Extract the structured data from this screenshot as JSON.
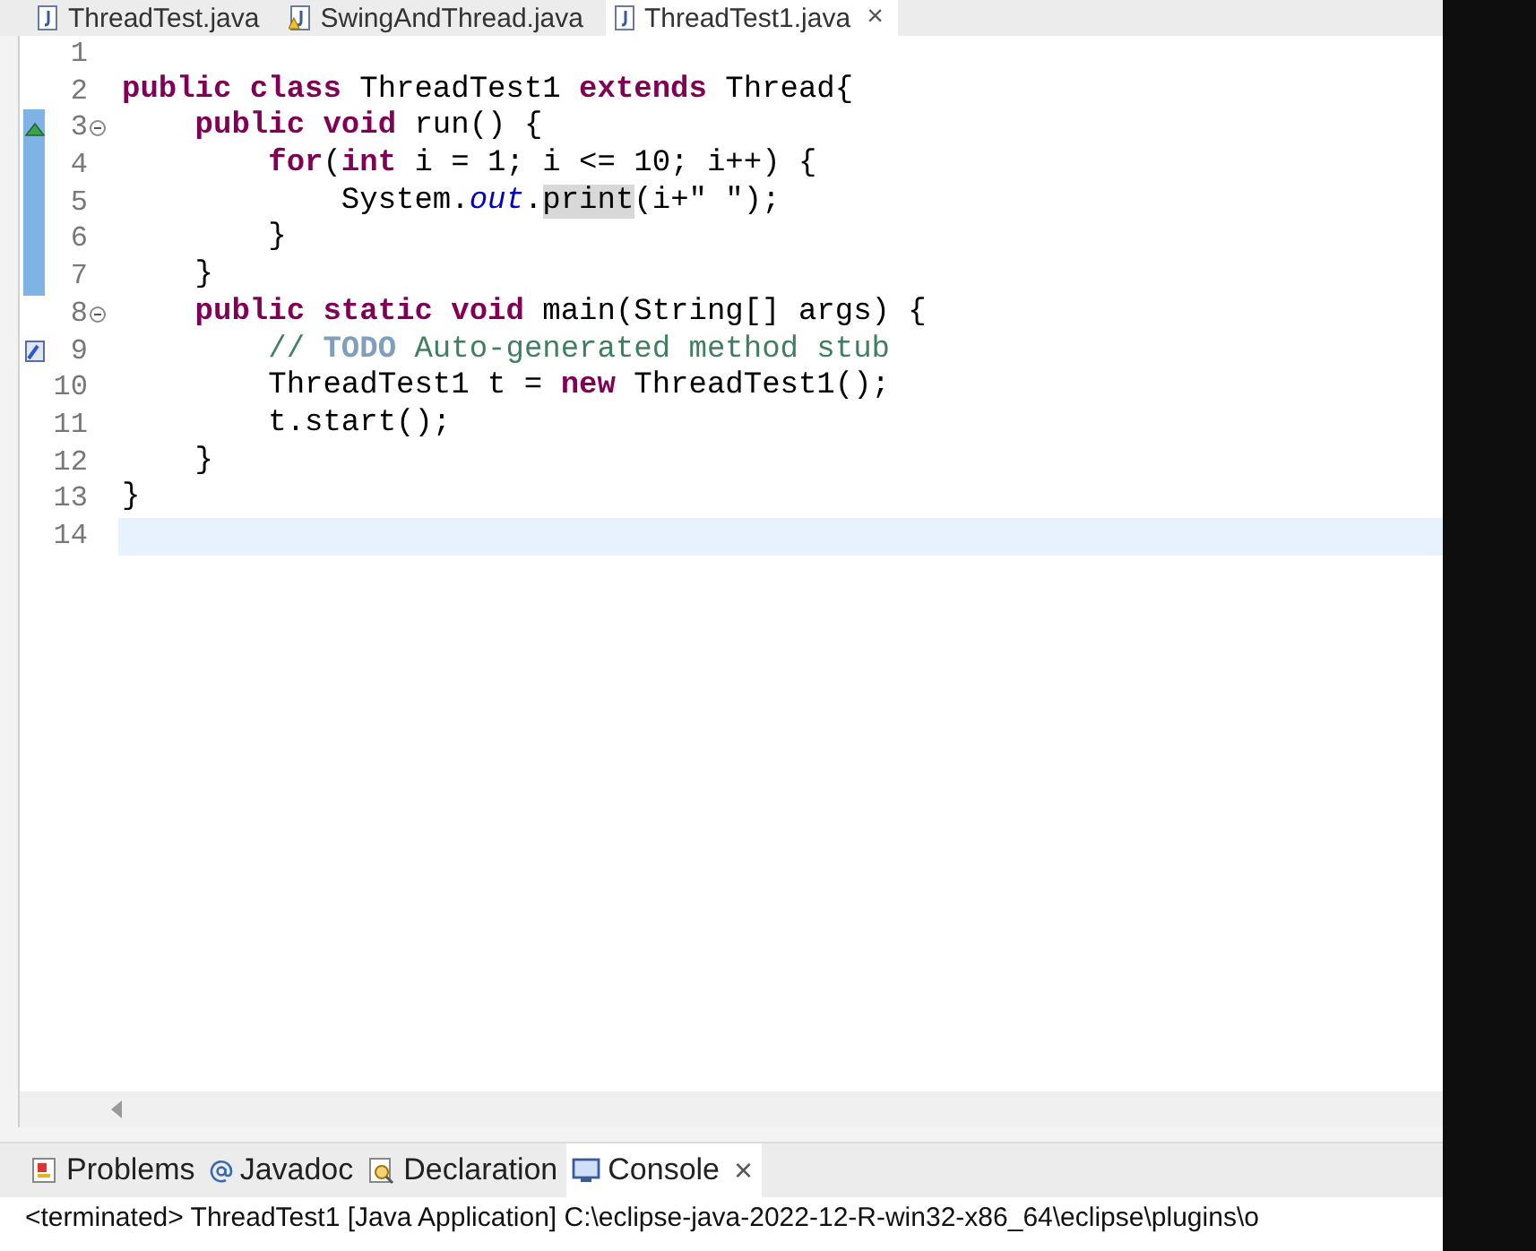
{
  "editor_tabs": [
    {
      "label": "ThreadTest.java",
      "warning": false,
      "selected": false
    },
    {
      "label": "SwingAndThread.java",
      "warning": true,
      "selected": false
    },
    {
      "label": "ThreadTest1.java",
      "warning": false,
      "selected": true,
      "close": "×"
    }
  ],
  "code_lines": [
    {
      "number": "1",
      "fold": false,
      "changed": false,
      "current": false,
      "override": false,
      "task": false
    },
    {
      "number": "2",
      "fold": false,
      "changed": false,
      "current": false,
      "override": false,
      "task": false,
      "tokens": [
        {
          "kind": "keyword",
          "text": "public class"
        },
        {
          "kind": "plain",
          "text": " ThreadTest1 "
        },
        {
          "kind": "keyword",
          "text": "extends"
        },
        {
          "kind": "plain",
          "text": " Thread{"
        }
      ]
    },
    {
      "number": "3",
      "fold": true,
      "changed": true,
      "current": false,
      "override": true,
      "task": false,
      "tokens": [
        {
          "kind": "keyword",
          "text": "    public void"
        },
        {
          "kind": "plain",
          "text": " run() {"
        }
      ]
    },
    {
      "number": "4",
      "fold": false,
      "changed": true,
      "current": false,
      "override": false,
      "task": false,
      "tokens": [
        {
          "kind": "keyword",
          "text": "        for"
        },
        {
          "kind": "plain",
          "text": "("
        },
        {
          "kind": "keyword",
          "text": "int"
        },
        {
          "kind": "plain",
          "text": " i = 1; i <= 10; i++) {"
        }
      ]
    },
    {
      "number": "5",
      "fold": false,
      "changed": true,
      "current": false,
      "override": false,
      "task": false,
      "tokens": [
        {
          "kind": "plain",
          "text": "            System."
        },
        {
          "kind": "field",
          "text": "out"
        },
        {
          "kind": "plain",
          "text": "."
        },
        {
          "kind": "occurrence",
          "text": "print"
        },
        {
          "kind": "plain",
          "text": "(i+\" \");"
        }
      ]
    },
    {
      "number": "6",
      "fold": false,
      "changed": true,
      "current": false,
      "override": false,
      "task": false,
      "tokens": [
        {
          "kind": "plain",
          "text": "        }"
        }
      ]
    },
    {
      "number": "7",
      "fold": false,
      "changed": true,
      "current": false,
      "override": false,
      "task": false,
      "tokens": [
        {
          "kind": "plain",
          "text": "    }"
        }
      ]
    },
    {
      "number": "8",
      "fold": true,
      "changed": false,
      "current": false,
      "override": false,
      "task": false,
      "tokens": [
        {
          "kind": "keyword",
          "text": "    public static void"
        },
        {
          "kind": "plain",
          "text": " main(String[] args) {"
        }
      ]
    },
    {
      "number": "9",
      "fold": false,
      "changed": false,
      "current": false,
      "override": false,
      "task": true,
      "tokens": [
        {
          "kind": "comment",
          "text": "        // "
        },
        {
          "kind": "todo",
          "text": "TODO"
        },
        {
          "kind": "comment",
          "text": " Auto-generated method stub"
        }
      ]
    },
    {
      "number": "10",
      "fold": false,
      "changed": false,
      "current": false,
      "override": false,
      "task": false,
      "tokens": [
        {
          "kind": "plain",
          "text": "        ThreadTest1 t = "
        },
        {
          "kind": "keyword",
          "text": "new"
        },
        {
          "kind": "plain",
          "text": " ThreadTest1();"
        }
      ]
    },
    {
      "number": "11",
      "fold": false,
      "changed": false,
      "current": false,
      "override": false,
      "task": false,
      "tokens": [
        {
          "kind": "plain",
          "text": "        t.start();"
        }
      ]
    },
    {
      "number": "12",
      "fold": false,
      "changed": false,
      "current": false,
      "override": false,
      "task": false,
      "tokens": [
        {
          "kind": "plain",
          "text": "    }"
        }
      ]
    },
    {
      "number": "13",
      "fold": false,
      "changed": false,
      "current": false,
      "override": false,
      "task": false,
      "tokens": [
        {
          "kind": "plain",
          "text": "}"
        }
      ]
    },
    {
      "number": "14",
      "fold": false,
      "changed": false,
      "current": true,
      "override": false,
      "task": false
    }
  ],
  "view_tabs": [
    {
      "label": "Problems",
      "kind": "problems",
      "selected": false
    },
    {
      "label": "Javadoc",
      "kind": "javadoc",
      "selected": false
    },
    {
      "label": "Declaration",
      "kind": "declaration",
      "selected": false
    },
    {
      "label": "Console",
      "kind": "console",
      "selected": true,
      "close": "×"
    }
  ],
  "console": {
    "status": "<terminated> ThreadTest1 [Java Application] C:\\eclipse-java-2022-12-R-win32-x86_64\\eclipse\\plugins\\o"
  }
}
